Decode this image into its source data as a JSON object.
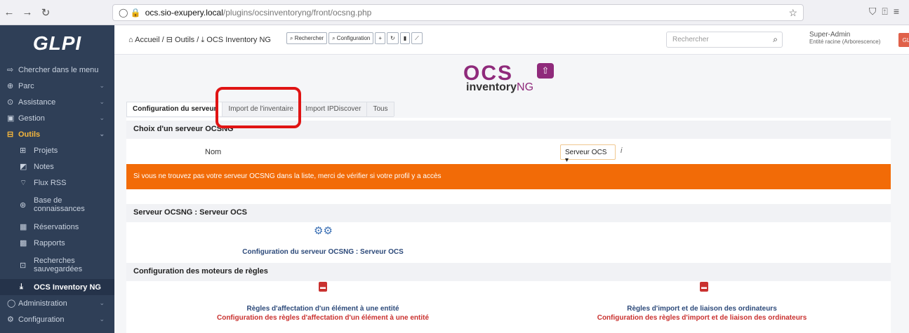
{
  "browser": {
    "url_host": "ocs.sio-exupery.local",
    "url_path": "/plugins/ocsinventoryng/front/ocsng.php"
  },
  "sidebar": {
    "logo": "GLPI",
    "search_menu": "Chercher dans le menu",
    "items": [
      {
        "label": "Parc"
      },
      {
        "label": "Assistance"
      },
      {
        "label": "Gestion"
      },
      {
        "label": "Outils"
      }
    ],
    "sub_items": [
      {
        "label": "Projets"
      },
      {
        "label": "Notes"
      },
      {
        "label": "Flux RSS"
      },
      {
        "label": "Base de connaissances"
      },
      {
        "label": "Réservations"
      },
      {
        "label": "Rapports"
      },
      {
        "label": "Recherches sauvegardées"
      },
      {
        "label": "OCS Inventory NG"
      }
    ],
    "bottom_items": [
      {
        "label": "Administration"
      },
      {
        "label": "Configuration"
      }
    ]
  },
  "header": {
    "breadcrumb_home": "Accueil",
    "breadcrumb_tools": "Outils",
    "breadcrumb_current": "OCS Inventory NG",
    "btn_search": "Rechercher",
    "btn_config": "Configuration",
    "search_placeholder": "Rechercher",
    "user_name": "Super-Admin",
    "user_entity": "Entité racine (Arborescence)",
    "avatar": "GL"
  },
  "logo": {
    "main": "OCS",
    "sub": "inventory",
    "ng": "NG"
  },
  "tabs": [
    {
      "label": "Configuration du serveur"
    },
    {
      "label": "Import de l'inventaire"
    },
    {
      "label": "Import IPDiscover"
    },
    {
      "label": "Tous"
    }
  ],
  "content": {
    "section1_title": "Choix d'un serveur OCSNG",
    "name_label": "Nom",
    "select_value": "Serveur OCS",
    "info_icon": "i",
    "alert": "Si vous ne trouvez pas votre serveur OCSNG dans la liste, merci de vérifier si votre profil y a accès",
    "section2_title": "Serveur OCSNG : Serveur OCS",
    "config_link": "Configuration du serveur OCSNG : Serveur OCS",
    "section3_title": "Configuration des moteurs de règles",
    "rule1_title": "Règles d'affectation d'un élément à une entité",
    "rule1_sub": "Configuration des règles d'affectation d'un élément à une entité",
    "rule2_title": "Règles d'import et de liaison des ordinateurs",
    "rule2_sub": "Configuration des règles d'import et de liaison des ordinateurs"
  },
  "colors": {
    "sidebar": "#2f3f57",
    "accent": "#f6b73c",
    "alert": "#f26b07",
    "ocs_purple": "#8f2a7b",
    "highlight": "#e01414"
  }
}
